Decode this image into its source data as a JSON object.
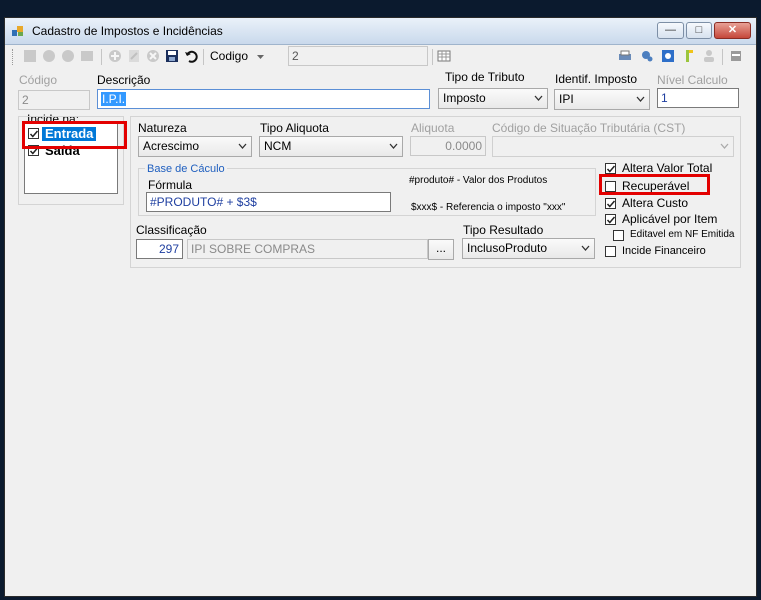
{
  "window": {
    "title": "Cadastro de Impostos e Incidências"
  },
  "toolbar": {
    "codigo_label": "Codigo",
    "codigo_value": "2"
  },
  "form": {
    "codigo_label": "Código",
    "codigo_value": "2",
    "descricao_label": "Descrição",
    "descricao_value": "I.P.I.",
    "tipo_tributo_label": "Tipo de Tributo",
    "tipo_tributo_value": "Imposto",
    "identif_imposto_label": "Identif. Imposto",
    "identif_imposto_value": "IPI",
    "nivel_calculo_label": "Nível Calculo",
    "nivel_calculo_value": "1",
    "incide_na_label": "Incide na:",
    "incide_items": [
      {
        "label": "Entrada",
        "checked": true
      },
      {
        "label": "Saída",
        "checked": true
      }
    ],
    "natureza_label": "Natureza",
    "natureza_value": "Acrescimo",
    "tipo_aliquota_label": "Tipo Aliquota",
    "tipo_aliquota_value": "NCM",
    "aliquota_label": "Aliquota",
    "aliquota_value": "0.0000",
    "cst_label": "Código de Situação Tributária (CST)",
    "cst_value": "",
    "base_calculo_label": "Base de Cáculo",
    "formula_label": "Fórmula",
    "formula_value": "#PRODUTO# + $3$",
    "hint_produto": "#produto# - Valor dos Produtos",
    "hint_xxx": "$xxx$ - Referencia o imposto \"xxx\"",
    "classificacao_label": "Classificação",
    "classificacao_code": "297",
    "classificacao_desc": "IPI SOBRE COMPRAS",
    "browse_label": "...",
    "tipo_resultado_label": "Tipo Resultado",
    "tipo_resultado_value": "InclusoProduto"
  },
  "options": [
    {
      "label": "Altera Valor Total",
      "checked": true
    },
    {
      "label": "Recuperável",
      "checked": false
    },
    {
      "label": "Altera Custo",
      "checked": true
    },
    {
      "label": "Aplicável por Item",
      "checked": true
    },
    {
      "label": "Editavel em NF Emitida",
      "checked": false
    },
    {
      "label": "Incide Financeiro",
      "checked": false
    }
  ],
  "colors": {
    "highlight": "#e30000",
    "selection": "#3399ff",
    "link_blue": "#1f5fbf"
  }
}
